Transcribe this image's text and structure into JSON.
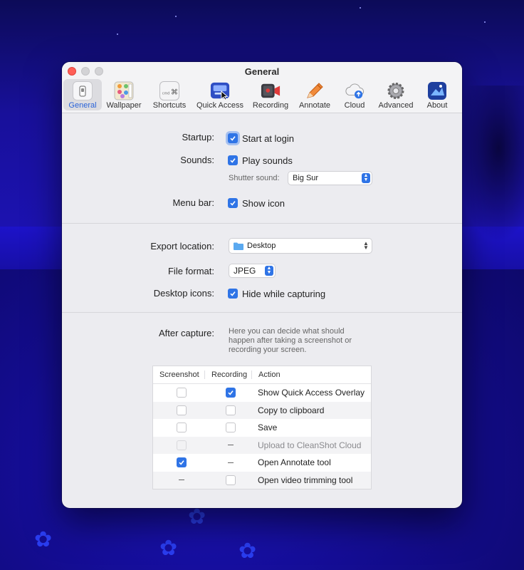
{
  "window": {
    "title": "General"
  },
  "toolbar": {
    "items": [
      {
        "label": "General",
        "icon": "general-switch-icon"
      },
      {
        "label": "Wallpaper",
        "icon": "wallpaper-icon"
      },
      {
        "label": "Shortcuts",
        "icon": "keyboard-shortcut-icon"
      },
      {
        "label": "Quick Access",
        "icon": "quick-access-icon"
      },
      {
        "label": "Recording",
        "icon": "video-camera-icon"
      },
      {
        "label": "Annotate",
        "icon": "pencil-icon"
      },
      {
        "label": "Cloud",
        "icon": "cloud-upload-icon"
      },
      {
        "label": "Advanced",
        "icon": "gear-icon"
      },
      {
        "label": "About",
        "icon": "app-icon"
      }
    ],
    "shortcut_icon_text": "cmd"
  },
  "general": {
    "startup_label": "Startup:",
    "start_at_login": "Start at login",
    "sounds_label": "Sounds:",
    "play_sounds": "Play sounds",
    "shutter_label": "Shutter sound:",
    "shutter_value": "Big Sur",
    "menubar_label": "Menu bar:",
    "show_icon": "Show icon"
  },
  "export": {
    "location_label": "Export location:",
    "location_value": "Desktop",
    "format_label": "File format:",
    "format_value": "JPEG",
    "desktop_icons_label": "Desktop icons:",
    "hide_while_capturing": "Hide while capturing"
  },
  "after_capture": {
    "label": "After capture:",
    "description": "Here you can decide what should happen after taking a screenshot or recording your screen.",
    "columns": [
      "Screenshot",
      "Recording",
      "Action"
    ],
    "rows": [
      {
        "screenshot": "unchecked",
        "recording": "checked",
        "action": "Show Quick Access Overlay"
      },
      {
        "screenshot": "unchecked",
        "recording": "unchecked",
        "action": "Copy to clipboard"
      },
      {
        "screenshot": "unchecked",
        "recording": "unchecked",
        "action": "Save"
      },
      {
        "screenshot": "disabled",
        "recording": "dash",
        "action": "Upload to CleanShot Cloud"
      },
      {
        "screenshot": "checked",
        "recording": "dash",
        "action": "Open Annotate tool"
      },
      {
        "screenshot": "dash",
        "recording": "unchecked",
        "action": "Open video trimming tool"
      }
    ]
  },
  "colors": {
    "accent": "#2f74e6",
    "close": "#ff5f57",
    "wallpaper": "#1c12b0"
  }
}
